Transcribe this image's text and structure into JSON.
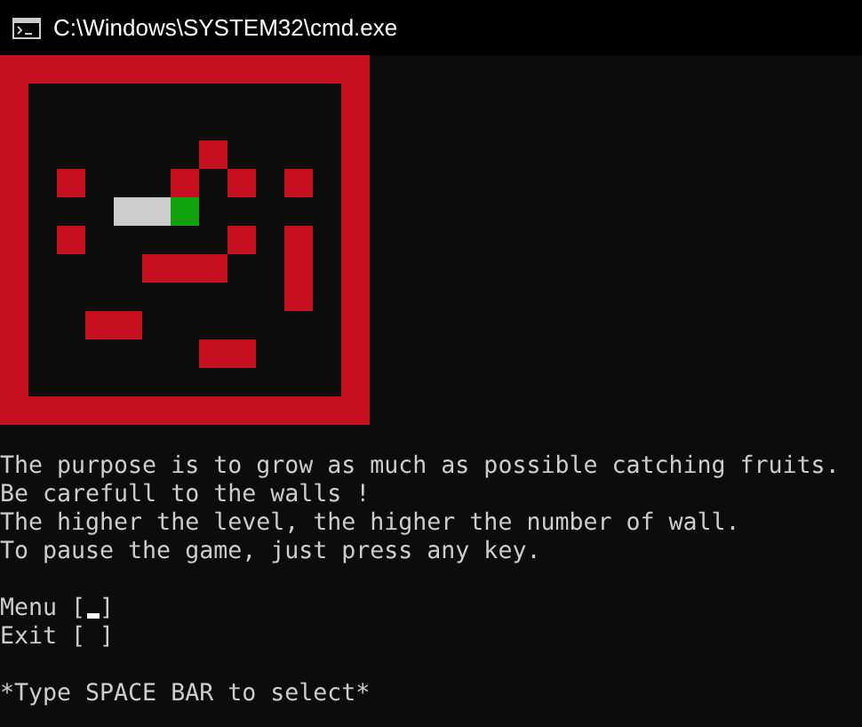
{
  "window": {
    "title": "C:\\Windows\\SYSTEM32\\cmd.exe"
  },
  "board": {
    "rows": [
      [
        {
          "kind": "empty"
        },
        {
          "kind": "empty"
        },
        {
          "kind": "empty"
        },
        {
          "kind": "empty"
        },
        {
          "kind": "empty"
        },
        {
          "kind": "empty"
        },
        {
          "kind": "empty"
        },
        {
          "kind": "empty"
        },
        {
          "kind": "empty"
        },
        {
          "kind": "empty"
        },
        {
          "kind": "empty"
        }
      ],
      [
        {
          "kind": "empty"
        },
        {
          "kind": "empty"
        },
        {
          "kind": "empty"
        },
        {
          "kind": "empty"
        },
        {
          "kind": "empty"
        },
        {
          "kind": "empty"
        },
        {
          "kind": "empty"
        },
        {
          "kind": "empty"
        },
        {
          "kind": "empty"
        },
        {
          "kind": "empty"
        },
        {
          "kind": "empty"
        }
      ],
      [
        {
          "kind": "empty"
        },
        {
          "kind": "empty"
        },
        {
          "kind": "empty"
        },
        {
          "kind": "empty"
        },
        {
          "kind": "empty"
        },
        {
          "kind": "empty"
        },
        {
          "kind": "wall"
        },
        {
          "kind": "empty"
        },
        {
          "kind": "empty"
        },
        {
          "kind": "empty"
        },
        {
          "kind": "empty"
        }
      ],
      [
        {
          "kind": "empty"
        },
        {
          "kind": "wall"
        },
        {
          "kind": "empty"
        },
        {
          "kind": "empty"
        },
        {
          "kind": "empty"
        },
        {
          "kind": "wall"
        },
        {
          "kind": "empty"
        },
        {
          "kind": "wall"
        },
        {
          "kind": "empty"
        },
        {
          "kind": "wall"
        },
        {
          "kind": "empty"
        }
      ],
      [
        {
          "kind": "empty"
        },
        {
          "kind": "empty"
        },
        {
          "kind": "empty"
        },
        {
          "kind": "body"
        },
        {
          "kind": "body"
        },
        {
          "kind": "head"
        },
        {
          "kind": "empty"
        },
        {
          "kind": "empty"
        },
        {
          "kind": "empty"
        },
        {
          "kind": "empty"
        },
        {
          "kind": "empty"
        }
      ],
      [
        {
          "kind": "empty"
        },
        {
          "kind": "wall"
        },
        {
          "kind": "empty"
        },
        {
          "kind": "empty"
        },
        {
          "kind": "empty"
        },
        {
          "kind": "empty"
        },
        {
          "kind": "empty"
        },
        {
          "kind": "wall"
        },
        {
          "kind": "empty"
        },
        {
          "kind": "wall"
        },
        {
          "kind": "empty"
        }
      ],
      [
        {
          "kind": "empty"
        },
        {
          "kind": "empty"
        },
        {
          "kind": "empty"
        },
        {
          "kind": "empty"
        },
        {
          "kind": "wall"
        },
        {
          "kind": "wall"
        },
        {
          "kind": "wall"
        },
        {
          "kind": "empty"
        },
        {
          "kind": "empty"
        },
        {
          "kind": "wall"
        },
        {
          "kind": "empty"
        }
      ],
      [
        {
          "kind": "empty"
        },
        {
          "kind": "empty"
        },
        {
          "kind": "empty"
        },
        {
          "kind": "empty"
        },
        {
          "kind": "empty"
        },
        {
          "kind": "empty"
        },
        {
          "kind": "empty"
        },
        {
          "kind": "empty"
        },
        {
          "kind": "empty"
        },
        {
          "kind": "wall"
        },
        {
          "kind": "empty"
        }
      ],
      [
        {
          "kind": "empty"
        },
        {
          "kind": "empty"
        },
        {
          "kind": "wall"
        },
        {
          "kind": "wall"
        },
        {
          "kind": "empty"
        },
        {
          "kind": "empty"
        },
        {
          "kind": "empty"
        },
        {
          "kind": "empty"
        },
        {
          "kind": "empty"
        },
        {
          "kind": "empty"
        },
        {
          "kind": "empty"
        }
      ],
      [
        {
          "kind": "empty"
        },
        {
          "kind": "empty"
        },
        {
          "kind": "empty"
        },
        {
          "kind": "empty"
        },
        {
          "kind": "empty"
        },
        {
          "kind": "empty"
        },
        {
          "kind": "wall"
        },
        {
          "kind": "wall"
        },
        {
          "kind": "empty"
        },
        {
          "kind": "empty"
        },
        {
          "kind": "empty"
        }
      ],
      [
        {
          "kind": "empty"
        },
        {
          "kind": "empty"
        },
        {
          "kind": "empty"
        },
        {
          "kind": "empty"
        },
        {
          "kind": "empty"
        },
        {
          "kind": "empty"
        },
        {
          "kind": "empty"
        },
        {
          "kind": "empty"
        },
        {
          "kind": "empty"
        },
        {
          "kind": "empty"
        },
        {
          "kind": "empty"
        }
      ]
    ]
  },
  "instructions": [
    "The purpose is to grow as much as possible catching fruits.",
    "Be carefull to the walls !",
    "The higher the level, the higher the number of wall.",
    "To pause the game, just press any key."
  ],
  "menu": [
    {
      "label": "Menu [",
      "close": "]",
      "selected": true
    },
    {
      "label": "Exit [",
      "close": "]",
      "selected": false
    }
  ],
  "hint": "*Type SPACE BAR to select*"
}
